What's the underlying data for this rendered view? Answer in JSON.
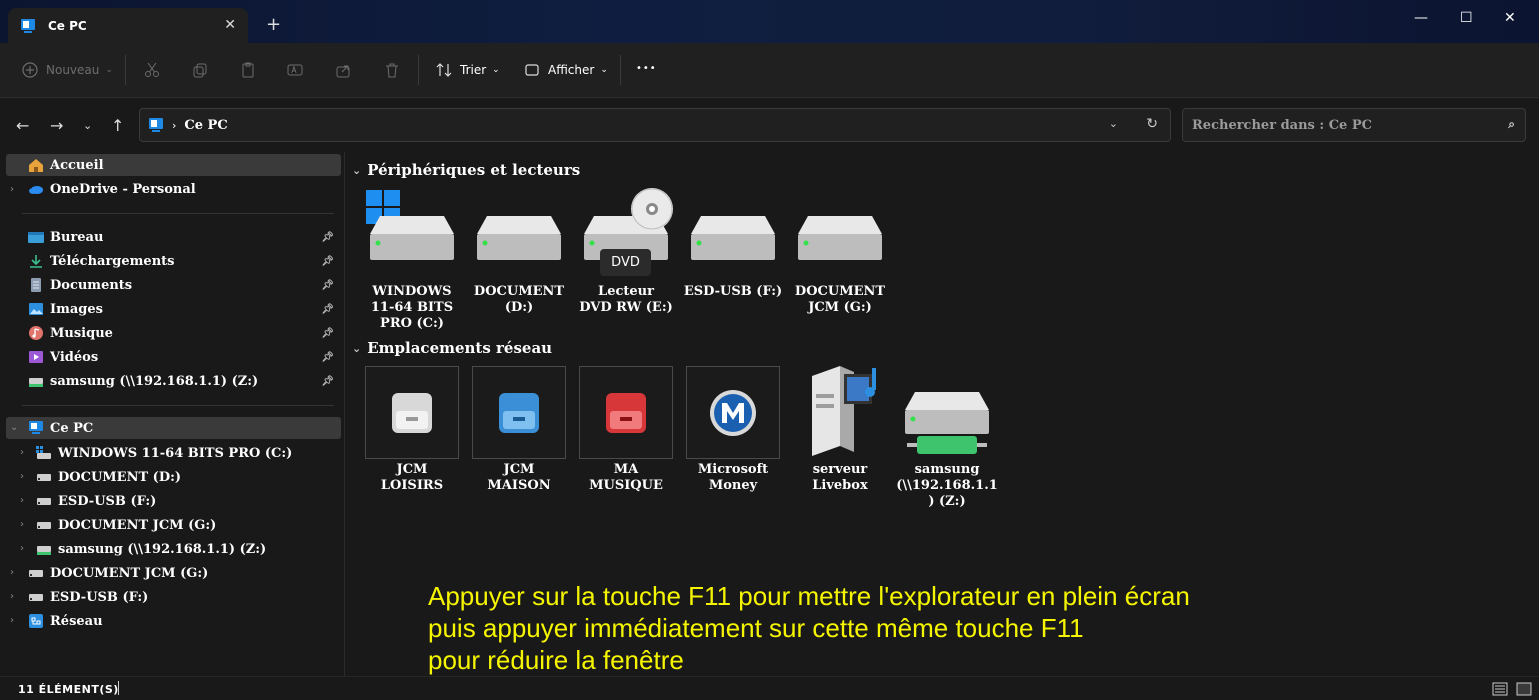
{
  "window": {
    "tab_title": "Ce PC",
    "tab_close": "✕",
    "new_tab": "+",
    "minimize": "—",
    "maximize": "☐",
    "close": "✕"
  },
  "toolbar": {
    "new_label": "Nouveau",
    "sort_label": "Trier",
    "view_label": "Afficher",
    "more_label": "•••"
  },
  "address": {
    "crumb": "Ce PC",
    "search_placeholder": "Rechercher dans : Ce PC"
  },
  "sidebar": {
    "home": "Accueil",
    "onedrive": "OneDrive - Personal",
    "quick": [
      {
        "label": "Bureau"
      },
      {
        "label": "Téléchargements"
      },
      {
        "label": "Documents"
      },
      {
        "label": "Images"
      },
      {
        "label": "Musique"
      },
      {
        "label": "Vidéos"
      },
      {
        "label": "samsung (\\\\192.168.1.1) (Z:)"
      }
    ],
    "this_pc": "Ce PC",
    "pc_children": [
      {
        "label": "WINDOWS 11-64 BITS PRO (C:)"
      },
      {
        "label": "DOCUMENT (D:)"
      },
      {
        "label": "ESD-USB (F:)"
      },
      {
        "label": "DOCUMENT JCM (G:)"
      },
      {
        "label": "samsung (\\\\192.168.1.1) (Z:)"
      }
    ],
    "bottom": [
      {
        "label": "DOCUMENT JCM (G:)"
      },
      {
        "label": "ESD-USB (F:)"
      },
      {
        "label": "Réseau"
      }
    ]
  },
  "devices": {
    "heading": "Périphériques et lecteurs",
    "dvd_badge": "DVD",
    "items": [
      {
        "lines": [
          "WINDOWS",
          "11-64 BITS",
          "PRO (C:)"
        ]
      },
      {
        "lines": [
          "DOCUMENT",
          "(D:)"
        ]
      },
      {
        "lines": [
          "Lecteur",
          "DVD RW (E:)"
        ]
      },
      {
        "lines": [
          "ESD-USB (F:)"
        ]
      },
      {
        "lines": [
          "DOCUMENT",
          "JCM (G:)"
        ]
      }
    ]
  },
  "network": {
    "heading": "Emplacements réseau",
    "items": [
      {
        "lines": [
          "JCM",
          "LOISIRS"
        ]
      },
      {
        "lines": [
          "JCM",
          "MAISON"
        ]
      },
      {
        "lines": [
          "MA",
          "MUSIQUE"
        ]
      },
      {
        "lines": [
          "Microsoft",
          "Money"
        ]
      },
      {
        "lines": [
          "serveur",
          "Livebox"
        ]
      },
      {
        "lines": [
          "samsung",
          "(\\\\192.168.1.1",
          ") (Z:)"
        ]
      }
    ]
  },
  "note": {
    "line1": "Appuyer sur la touche F11 pour mettre l'explorateur en plein écran",
    "line2": "puis appuyer immédiatement sur cette même touche F11",
    "line3": "pour réduire la fenêtre"
  },
  "status": {
    "count": "11 élément(s)"
  },
  "colors": {
    "accent": "#0078d4",
    "note_text": "#f5f500",
    "background": "#191919"
  }
}
